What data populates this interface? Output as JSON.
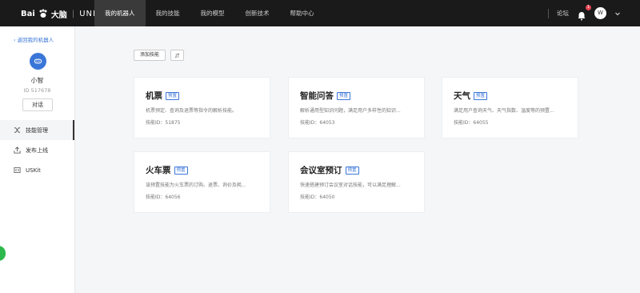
{
  "header": {
    "logo_text": "Bai",
    "logo_cn": "大脑",
    "logo_sep": "|",
    "logo_product": "UNIT",
    "nav": [
      {
        "label": "我的机器人"
      },
      {
        "label": "我的技能"
      },
      {
        "label": "我的模型"
      },
      {
        "label": "创新技术"
      },
      {
        "label": "帮助中心"
      }
    ],
    "forum_label": "论坛",
    "notification_badge": "1",
    "avatar_letter": "W"
  },
  "sidebar": {
    "back_label": "返回我的机器人",
    "bot_name": "小智",
    "bot_id": "ID 517678",
    "chat_button": "对话",
    "menu": [
      {
        "label": "技能管理",
        "icon": "shuffle-icon"
      },
      {
        "label": "发布上线",
        "icon": "upload-icon"
      },
      {
        "label": "USKit",
        "icon": "code-icon"
      }
    ]
  },
  "toolbar": {
    "add_skill_label": "添加技能"
  },
  "cards": [
    {
      "title": "机票",
      "tag": "预置",
      "desc": "机票预定、查询及退票等指令的解析技能。",
      "id": "技能ID：51875"
    },
    {
      "title": "智能问答",
      "tag": "预置",
      "desc": "解析通用型知识问题，满足用户多样性的知识...",
      "id": "技能ID：64053"
    },
    {
      "title": "天气",
      "tag": "预置",
      "desc": "满足用户查询天气、天气指数、温度等的预置...",
      "id": "技能ID：64055"
    },
    {
      "title": "火车票",
      "tag": "预置",
      "desc": "该预置技能为火车票的订购、退票、询价及耗...",
      "id": "技能ID：64056"
    },
    {
      "title": "会议室预订",
      "tag": "预置",
      "desc": "快速搭建预订会议室对话技能，可以满足理解...",
      "id": "技能ID：64050"
    }
  ],
  "colors": {
    "accent": "#3a76d8",
    "topbar": "#1a1a1a",
    "badge": "#e64552"
  }
}
